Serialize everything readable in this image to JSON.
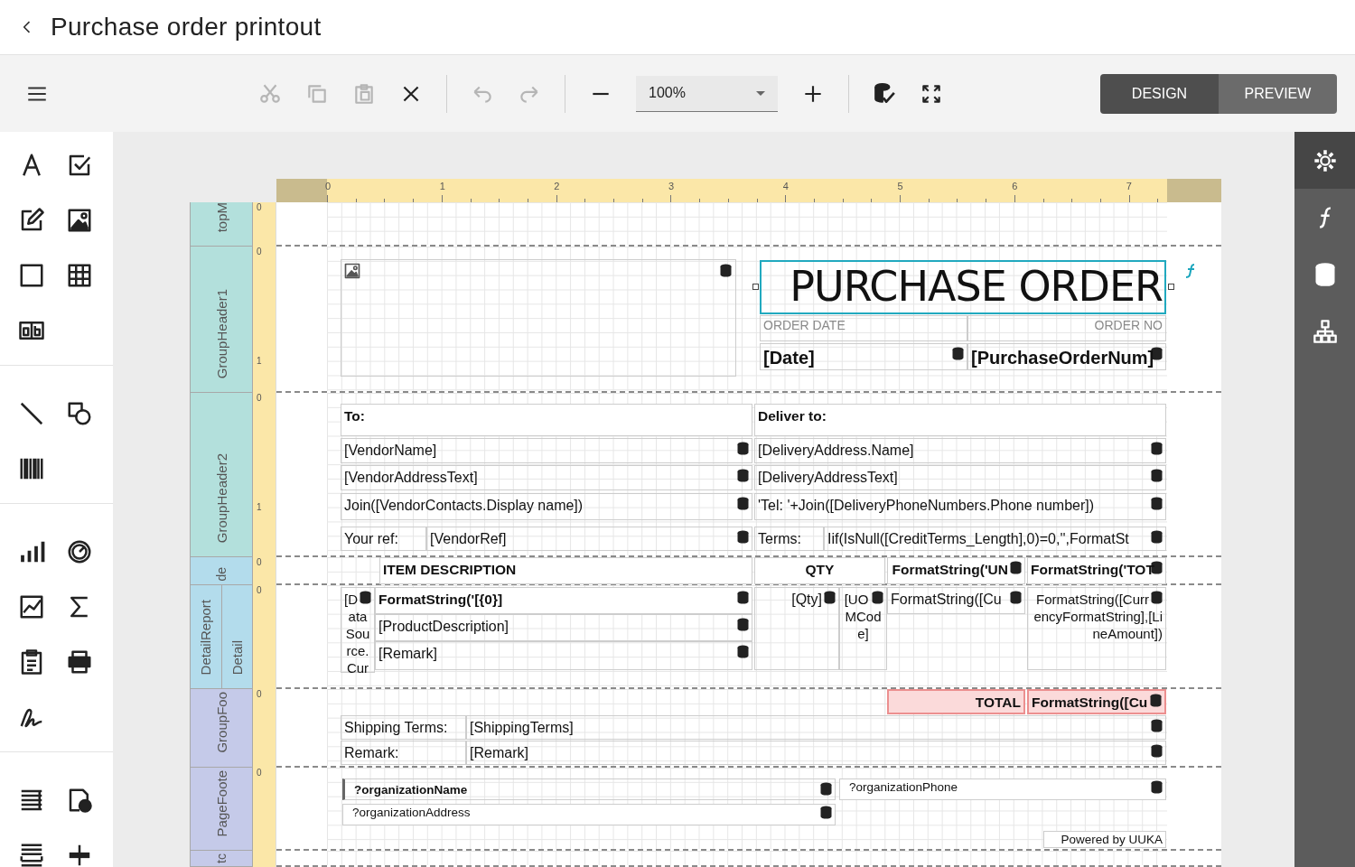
{
  "title": "Purchase order printout",
  "toolbar": {
    "buttons": [
      {
        "kind": "cut",
        "disabled": true
      },
      {
        "kind": "copy",
        "disabled": true
      },
      {
        "kind": "paste",
        "disabled": true
      },
      {
        "kind": "delete",
        "disabled": false
      },
      {
        "kind": "undo",
        "disabled": true
      },
      {
        "kind": "redo",
        "disabled": true
      }
    ],
    "zoom": "100%",
    "modes": [
      {
        "label": "DESIGN",
        "selected": true
      },
      {
        "label": "PREVIEW",
        "selected": false
      }
    ]
  },
  "side_panel": {
    "tabs": [
      {
        "kind": "settings",
        "selected": true
      },
      {
        "kind": "function",
        "selected": false
      },
      {
        "kind": "data",
        "selected": false
      },
      {
        "kind": "structure",
        "selected": false
      }
    ]
  },
  "ruler": {
    "labels": [
      "0",
      "1",
      "2",
      "3",
      "4",
      "5",
      "6",
      "7"
    ]
  },
  "bands": [
    {
      "label": "topM",
      "color": "#b3e0dc",
      "ruler_labels": [
        "0"
      ]
    },
    {
      "label": "GroupHeader1",
      "color": "#b3e0dc",
      "ruler_labels": [
        "0",
        "1"
      ],
      "controls": [
        {
          "kind": "image",
          "bound": true,
          "selected": false
        },
        {
          "kind": "title",
          "text": "PURCHASE ORDER",
          "bound": false,
          "selected": true
        },
        {
          "kind": "caption",
          "text": "ORDER DATE",
          "bound": false,
          "selected": false
        },
        {
          "kind": "caption",
          "text": "ORDER NO",
          "bound": false,
          "selected": false
        },
        {
          "kind": "heading-large",
          "text": "[Date]",
          "bound": true,
          "selected": false
        },
        {
          "kind": "heading-large",
          "text": "[PurchaseOrderNum]",
          "bound": true,
          "selected": false
        }
      ]
    },
    {
      "label": "GroupHeader2",
      "color": "#b3e0dc",
      "ruler_labels": [
        "0",
        "1"
      ],
      "controls": [
        {
          "kind": "heading",
          "text": "To:",
          "bound": false,
          "selected": false
        },
        {
          "kind": "heading",
          "text": "Deliver to:",
          "bound": false,
          "selected": false
        },
        {
          "kind": "field",
          "text": "[VendorName]",
          "bound": true,
          "selected": false
        },
        {
          "kind": "field",
          "text": "[DeliveryAddress.Name]",
          "bound": true,
          "selected": false
        },
        {
          "kind": "field",
          "text": "[VendorAddressText]",
          "bound": true,
          "selected": false
        },
        {
          "kind": "field",
          "text": "[DeliveryAddressText]",
          "bound": true,
          "selected": false
        },
        {
          "kind": "field",
          "text": "Join([VendorContacts.Display name])",
          "bound": true,
          "selected": false
        },
        {
          "kind": "field",
          "text": "'Tel: '+Join([DeliveryPhoneNumbers.Phone number])",
          "bound": true,
          "selected": false
        },
        {
          "kind": "field",
          "text": "Your ref:",
          "bound": false,
          "selected": false
        },
        {
          "kind": "field",
          "text": "[VendorRef]",
          "bound": true,
          "selected": false
        },
        {
          "kind": "field",
          "text": "Terms:",
          "bound": false,
          "selected": false
        },
        {
          "kind": "field",
          "text": "Iif(IsNull([CreditTerms_Length],0)=0,'',FormatSt",
          "bound": true,
          "selected": false
        }
      ]
    },
    {
      "label": "de",
      "color": "#b3dcec",
      "ruler_labels": [
        "0"
      ],
      "controls": [
        {
          "kind": "heading",
          "text": "ITEM DESCRIPTION",
          "bound": false,
          "selected": false
        },
        {
          "kind": "heading",
          "text": "QTY",
          "bound": false,
          "selected": false
        },
        {
          "kind": "heading",
          "text": "FormatString('UN",
          "bound": true,
          "selected": false
        },
        {
          "kind": "heading",
          "text": "FormatString('TOT",
          "bound": true,
          "selected": false
        }
      ]
    },
    {
      "label": "DetailReport",
      "color": "#b3dcec",
      "ruler_labels": [
        "0"
      ],
      "children": [
        {
          "label": "Detail",
          "color": "#b3dcec"
        }
      ],
      "controls": [
        {
          "kind": "field",
          "text": "[DataSource.Cur",
          "bound": true,
          "selected": false
        },
        {
          "kind": "heading",
          "text": "FormatString('[{0}]",
          "bound": true,
          "selected": false
        },
        {
          "kind": "field",
          "text": "[ProductDescription]",
          "bound": true,
          "selected": false
        },
        {
          "kind": "field",
          "text": "[Remark]",
          "bound": true,
          "selected": false
        },
        {
          "kind": "field",
          "text": "[Qty]",
          "bound": true,
          "selected": false
        },
        {
          "kind": "field",
          "text": "[UOMCode]",
          "bound": true,
          "selected": false
        },
        {
          "kind": "field",
          "text": "FormatString([Cu",
          "bound": true,
          "selected": false
        },
        {
          "kind": "field",
          "text": "FormatString([CurrencyFormatString],[LineAmount])",
          "bound": true,
          "selected": false
        }
      ]
    },
    {
      "label": "GroupFoo",
      "color": "#c5cae9",
      "ruler_labels": [
        "0"
      ],
      "controls": [
        {
          "kind": "total",
          "text": "TOTAL",
          "bound": false,
          "selected": false
        },
        {
          "kind": "total",
          "text": "FormatString([Cu",
          "bound": true,
          "selected": false
        },
        {
          "kind": "field",
          "text": "Shipping Terms:",
          "bound": false,
          "selected": false
        },
        {
          "kind": "field",
          "text": "[ShippingTerms]",
          "bound": true,
          "selected": false
        },
        {
          "kind": "field",
          "text": "Remark:",
          "bound": false,
          "selected": false
        },
        {
          "kind": "field",
          "text": "[Remark]",
          "bound": true,
          "selected": false
        }
      ]
    },
    {
      "label": "PageFoote",
      "color": "#c5cae9",
      "ruler_labels": [
        "0"
      ],
      "controls": [
        {
          "kind": "small-bold",
          "text": "?organizationName",
          "bound": true,
          "selected": false
        },
        {
          "kind": "small",
          "text": "?organizationAddress",
          "bound": true,
          "selected": false
        },
        {
          "kind": "small",
          "text": "?organizationPhone",
          "bound": true,
          "selected": false
        },
        {
          "kind": "small",
          "text": "Powered by UUKA",
          "bound": false,
          "selected": false
        }
      ]
    },
    {
      "label": "tc",
      "color": "#c5cae9"
    }
  ]
}
